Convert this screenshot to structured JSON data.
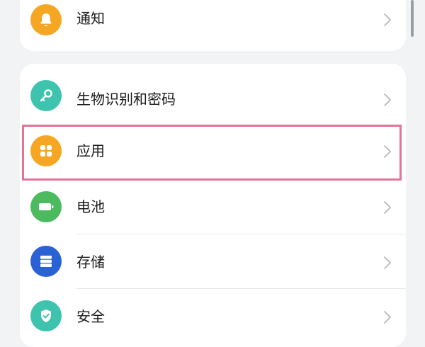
{
  "settings": {
    "notification": {
      "label": "通知",
      "icon": "bell-icon",
      "color": "#f5a623"
    },
    "biometrics": {
      "label": "生物识别和密码",
      "icon": "key-icon",
      "color": "#3ec3ae"
    },
    "apps": {
      "label": "应用",
      "icon": "apps-grid-icon",
      "color": "#f5a623"
    },
    "battery": {
      "label": "电池",
      "icon": "battery-icon",
      "color": "#4cba5f"
    },
    "storage": {
      "label": "存储",
      "icon": "storage-icon",
      "color": "#2a62d6"
    },
    "security": {
      "label": "安全",
      "icon": "shield-check-icon",
      "color": "#3ec3ae"
    }
  },
  "highlight_color": "#e4739a"
}
